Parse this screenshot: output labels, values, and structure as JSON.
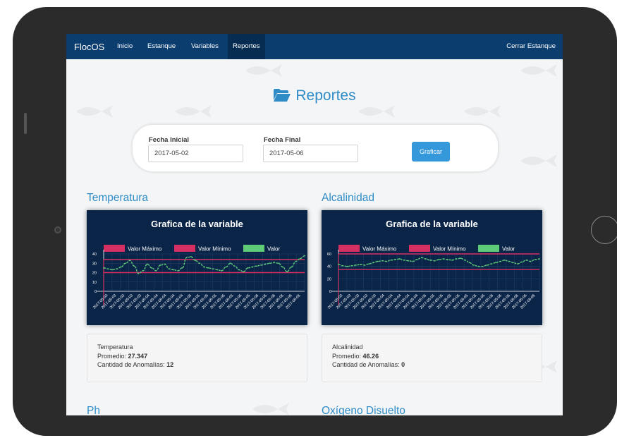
{
  "navbar": {
    "brand": "FlocOS",
    "items": [
      {
        "label": "Inicio"
      },
      {
        "label": "Estanque"
      },
      {
        "label": "Variables"
      },
      {
        "label": "Reportes",
        "active": true
      }
    ],
    "right": "Cerrar Estanque"
  },
  "page": {
    "title": "Reportes",
    "icon": "folder-open-icon"
  },
  "filters": {
    "start_label": "Fecha Inicial",
    "start_value": "2017-05-02",
    "end_label": "Fecha Final",
    "end_value": "2017-05-06",
    "button": "Graficar"
  },
  "sections": [
    {
      "title": "Temperatura",
      "stats": {
        "name": "Temperatura",
        "avg_label": "Promedio:",
        "avg": "27.347",
        "anom_label": "Cantidad de Anomalías:",
        "anom": "12"
      }
    },
    {
      "title": "Alcalinidad",
      "stats": {
        "name": "Alcalinidad",
        "avg_label": "Promedio:",
        "avg": "46.26",
        "anom_label": "Cantidad de Anomalías:",
        "anom": "0"
      }
    },
    {
      "title": "Ph"
    },
    {
      "title": "Oxígeno Disuelto"
    }
  ],
  "colors": {
    "navbar": "#0b3d6e",
    "accent": "#2f8cc6",
    "button": "#3498db",
    "chart_bg": "#0b2548",
    "max_line": "#d63063",
    "min_line": "#d63063",
    "value_line": "#5ecb79"
  },
  "chart_data": [
    {
      "type": "line",
      "title": "Grafica de la variable",
      "legend": [
        "Valor Máximo",
        "Valor Mínimo",
        "Valor"
      ],
      "legend_position": "top",
      "ylim": [
        0,
        40
      ],
      "yticks": [
        0,
        10,
        20,
        30,
        40
      ],
      "x": [
        "2017-05-03",
        "2017-05-03",
        "2017-05-03",
        "2017-05-03",
        "2017-05-03",
        "2017-05-04",
        "2017-05-04",
        "2017-05-04",
        "2017-05-04",
        "2017-05-04",
        "2017-05-05",
        "2017-05-05",
        "2017-05-05",
        "2017-05-05",
        "2017-05-05",
        "2017-05-05",
        "2017-05-05",
        "2017-05-05",
        "2017-05-06",
        "2017-05-06",
        "2017-05-06",
        "2017-05-06",
        "2017-05-06",
        "2017-05-06"
      ],
      "series": [
        {
          "name": "Valor Máximo",
          "values": [
            34,
            34,
            34,
            34,
            34,
            34,
            34,
            34,
            34,
            34,
            34,
            34,
            34,
            34,
            34,
            34,
            34,
            34,
            34,
            34,
            34,
            34,
            34,
            34,
            34,
            34,
            34,
            34,
            34,
            34,
            34,
            34,
            34,
            34,
            34,
            34,
            34,
            34,
            34,
            34,
            34,
            34,
            34,
            34,
            34,
            34,
            34
          ]
        },
        {
          "name": "Valor Mínimo",
          "values": [
            20,
            20,
            20,
            20,
            20,
            20,
            20,
            20,
            20,
            20,
            20,
            20,
            20,
            20,
            20,
            20,
            20,
            20,
            20,
            20,
            20,
            20,
            20,
            20,
            20,
            20,
            20,
            20,
            20,
            20,
            20,
            20,
            20,
            20,
            20,
            20,
            20,
            20,
            20,
            20,
            20,
            20,
            20,
            20,
            20,
            20,
            20
          ]
        },
        {
          "name": "Valor",
          "values": [
            25,
            24,
            23,
            24,
            26,
            30,
            33,
            27,
            19,
            22,
            29,
            25,
            22,
            28,
            29,
            24,
            23,
            22,
            25,
            36,
            37,
            33,
            30,
            26,
            25,
            24,
            23,
            22,
            26,
            30,
            27,
            23,
            21,
            25,
            26,
            27,
            28,
            29,
            30,
            31,
            30,
            26,
            21,
            26,
            32,
            35,
            38
          ]
        }
      ]
    },
    {
      "type": "line",
      "title": "Grafica de la variable",
      "legend": [
        "Valor Máximo",
        "Valor Mínimo",
        "Valor"
      ],
      "legend_position": "top",
      "ylim": [
        0,
        60
      ],
      "yticks": [
        0,
        20,
        40,
        60
      ],
      "x": [
        "2017-05-03",
        "2017-05-03",
        "2017-05-03",
        "2017-05-03",
        "2017-05-03",
        "2017-05-04",
        "2017-05-04",
        "2017-05-04",
        "2017-05-04",
        "2017-05-04",
        "2017-05-05",
        "2017-05-05",
        "2017-05-05",
        "2017-05-05",
        "2017-05-05",
        "2017-05-05",
        "2017-05-05",
        "2017-05-05",
        "2017-05-06",
        "2017-05-06",
        "2017-05-06",
        "2017-05-06",
        "2017-05-06",
        "2017-05-06"
      ],
      "series": [
        {
          "name": "Valor Máximo",
          "values": [
            60,
            60,
            60,
            60,
            60,
            60,
            60,
            60,
            60,
            60,
            60,
            60,
            60,
            60,
            60,
            60,
            60,
            60,
            60,
            60,
            60,
            60,
            60,
            60,
            60,
            60,
            60,
            60,
            60,
            60,
            60,
            60,
            60,
            60,
            60,
            60,
            60,
            60,
            60,
            60,
            60,
            60,
            60,
            60,
            60,
            60,
            60
          ]
        },
        {
          "name": "Valor Mínimo",
          "values": [
            35,
            35,
            35,
            35,
            35,
            35,
            35,
            35,
            35,
            35,
            35,
            35,
            35,
            35,
            35,
            35,
            35,
            35,
            35,
            35,
            35,
            35,
            35,
            35,
            35,
            35,
            35,
            35,
            35,
            35,
            35,
            35,
            35,
            35,
            35,
            35,
            35,
            35,
            35,
            35,
            35,
            35,
            35,
            35,
            35,
            35,
            35
          ]
        },
        {
          "name": "Valor",
          "values": [
            43,
            41,
            40,
            41,
            42,
            43,
            42,
            44,
            46,
            48,
            49,
            48,
            50,
            51,
            52,
            50,
            49,
            48,
            51,
            54,
            52,
            50,
            49,
            51,
            52,
            51,
            50,
            52,
            53,
            50,
            46,
            42,
            40,
            40,
            42,
            44,
            46,
            48,
            50,
            48,
            46,
            44,
            47,
            50,
            48,
            51,
            52
          ]
        }
      ]
    }
  ]
}
